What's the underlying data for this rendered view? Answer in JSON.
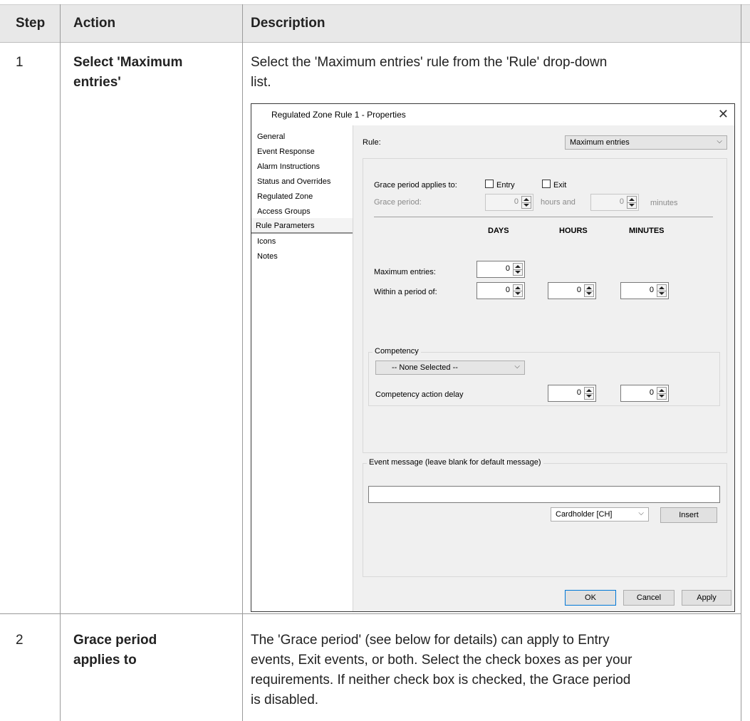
{
  "table": {
    "headers": {
      "step": "Step",
      "action": "Action",
      "description": "Description"
    },
    "rows": [
      {
        "step": "1",
        "action_line1": "Select 'Maximum",
        "action_line2": "entries'",
        "desc_line1": "Select the 'Maximum entries' rule from the 'Rule' drop-down",
        "desc_line2": "list."
      },
      {
        "step": "2",
        "action_line1": "Grace period",
        "action_line2": "applies to",
        "desc_line1": "The 'Grace period' (see below for details) can apply to Entry",
        "desc_line2": "events, Exit events, or both. Select the check boxes as per your",
        "desc_line3": "requirements. If neither check box is checked, the Grace period",
        "desc_line4": "is disabled."
      }
    ]
  },
  "dialog": {
    "title": "Regulated Zone Rule 1 - Properties",
    "close_glyph": "✕",
    "nav": [
      "General",
      "Event Response",
      "Alarm Instructions",
      "Status and Overrides",
      "Regulated Zone",
      "Access Groups",
      "Rule Parameters",
      "Icons",
      "Notes"
    ],
    "rule_label": "Rule:",
    "rule_value": "Maximum entries",
    "grace_applies_label": "Grace period applies to:",
    "entry_label": "Entry",
    "exit_label": "Exit",
    "grace_period_label": "Grace period:",
    "grace_hours": "0",
    "hours_and": "hours and",
    "grace_minutes": "0",
    "minutes": "minutes",
    "col_days": "DAYS",
    "col_hours": "HOURS",
    "col_minutes": "MINUTES",
    "max_entries_label": "Maximum entries:",
    "max_entries_value": "0",
    "within_label": "Within a period of:",
    "within_days": "0",
    "within_hours": "0",
    "within_minutes": "0",
    "competency_caption": "Competency",
    "competency_value": "-- None Selected --",
    "competency_delay_label": "Competency action delay",
    "competency_hours": "0",
    "competency_minutes": "0",
    "event_caption": "Event message (leave blank for default message)",
    "event_message": "",
    "cardholder_value": "Cardholder [CH]",
    "insert_label": "Insert",
    "ok_label": "OK",
    "cancel_label": "Cancel",
    "apply_label": "Apply",
    "chevron_glyph": "⌵"
  }
}
